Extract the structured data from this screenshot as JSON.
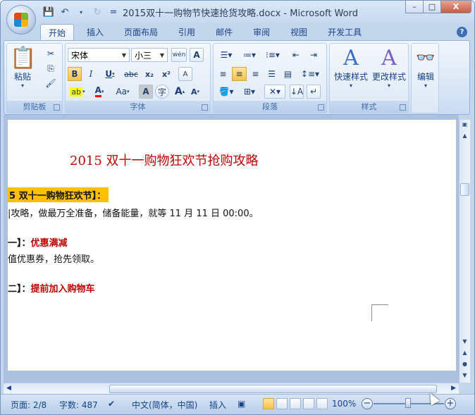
{
  "window": {
    "title": "2015双十一购物节快速抢货攻略.docx - Microsoft Word",
    "controls": {
      "minimize": "–",
      "maximize": "□",
      "close": "X"
    }
  },
  "quick_access": {
    "save_icon": "save-icon",
    "undo_icon": "undo-icon",
    "redo_icon": "redo-icon",
    "customize": "="
  },
  "tabs": [
    {
      "label": "开始",
      "active": true
    },
    {
      "label": "插入"
    },
    {
      "label": "页面布局"
    },
    {
      "label": "引用"
    },
    {
      "label": "邮件"
    },
    {
      "label": "审阅"
    },
    {
      "label": "视图"
    },
    {
      "label": "开发工具"
    }
  ],
  "ribbon": {
    "clipboard": {
      "label": "剪贴板",
      "paste": "粘贴"
    },
    "font": {
      "label": "字体",
      "font_name": "宋体",
      "font_size": "小三",
      "wen": "wén\n文",
      "bold": "B",
      "italic": "I",
      "underline": "U",
      "strike": "abc",
      "subscript": "x₂",
      "superscript": "x²",
      "clear": "A",
      "case": "Aa",
      "grow": "A",
      "shrink": "A",
      "highlight_color": "#ffff00",
      "font_color": "#ff0000"
    },
    "paragraph": {
      "label": "段落"
    },
    "styles": {
      "label": "样式",
      "quick_styles": "快速样式",
      "change_styles": "更改样式"
    },
    "editing": {
      "label": "编辑"
    }
  },
  "document": {
    "title": "2015 双十一购物狂欢节抢购攻略",
    "heading1": "5 双十一购物狂欢节】：",
    "line1": "|攻略，做最万全准备，储备能量，就等 11 月 11 日 00:00。",
    "line2_prefix": "一】：",
    "line2_red": "优惠满减",
    "line3": "值优惠券，抢先领取。",
    "line4_prefix": "二】：",
    "line4_red": "提前加入购物车"
  },
  "status": {
    "page": "页面: 2/8",
    "words": "字数: 487",
    "language": "中文(简体，中国)",
    "insert_mode": "插入",
    "zoom": "100%",
    "zoom_level": 100
  }
}
